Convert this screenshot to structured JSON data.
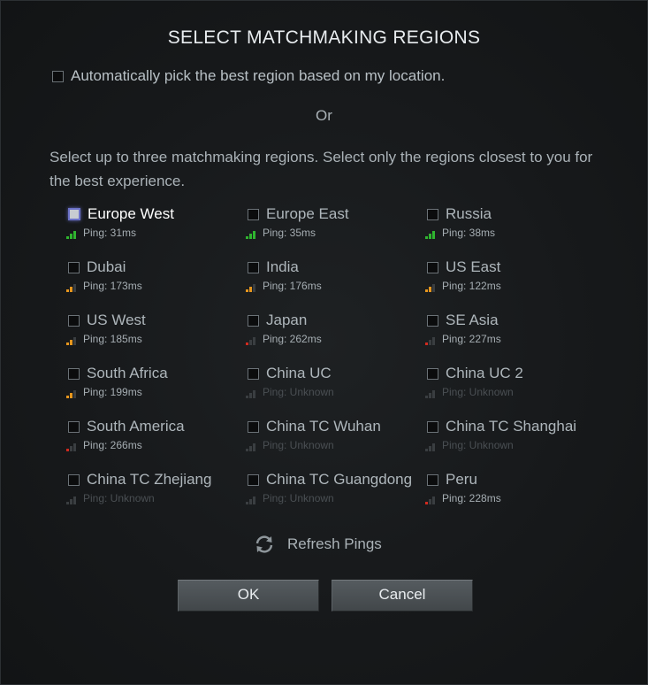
{
  "dialog": {
    "title": "SELECT MATCHMAKING REGIONS",
    "auto_pick_label": "Automatically pick the best region based on my location.",
    "auto_pick_checked": false,
    "or_text": "Or",
    "instructions": "Select up to three matchmaking regions. Select only the regions closest to you for the best experience.",
    "refresh_label": "Refresh Pings",
    "ok_label": "OK",
    "cancel_label": "Cancel"
  },
  "colors": {
    "good": "#2fb52f",
    "medium": "#e6961e",
    "poor": "#d12a1f",
    "unknown": "#3a3e41"
  },
  "regions": [
    {
      "name": "Europe West",
      "ping": "Ping: 31ms",
      "quality": "good",
      "bars": 3,
      "focused": true
    },
    {
      "name": "Europe East",
      "ping": "Ping: 35ms",
      "quality": "good",
      "bars": 3,
      "focused": false
    },
    {
      "name": "Russia",
      "ping": "Ping: 38ms",
      "quality": "good",
      "bars": 3,
      "focused": false
    },
    {
      "name": "Dubai",
      "ping": "Ping: 173ms",
      "quality": "medium",
      "bars": 2,
      "focused": false
    },
    {
      "name": "India",
      "ping": "Ping: 176ms",
      "quality": "medium",
      "bars": 2,
      "focused": false
    },
    {
      "name": "US East",
      "ping": "Ping: 122ms",
      "quality": "medium",
      "bars": 2,
      "focused": false
    },
    {
      "name": "US West",
      "ping": "Ping: 185ms",
      "quality": "medium",
      "bars": 2,
      "focused": false
    },
    {
      "name": "Japan",
      "ping": "Ping: 262ms",
      "quality": "poor",
      "bars": 1,
      "focused": false
    },
    {
      "name": "SE Asia",
      "ping": "Ping: 227ms",
      "quality": "poor",
      "bars": 1,
      "focused": false
    },
    {
      "name": "South Africa",
      "ping": "Ping: 199ms",
      "quality": "medium",
      "bars": 2,
      "focused": false
    },
    {
      "name": "China UC",
      "ping": "Ping: Unknown",
      "quality": "unknown",
      "bars": 0,
      "focused": false
    },
    {
      "name": "China UC 2",
      "ping": "Ping: Unknown",
      "quality": "unknown",
      "bars": 0,
      "focused": false
    },
    {
      "name": "South America",
      "ping": "Ping: 266ms",
      "quality": "poor",
      "bars": 1,
      "focused": false
    },
    {
      "name": "China TC Wuhan",
      "ping": "Ping: Unknown",
      "quality": "unknown",
      "bars": 0,
      "focused": false
    },
    {
      "name": "China TC Shanghai",
      "ping": "Ping: Unknown",
      "quality": "unknown",
      "bars": 0,
      "focused": false
    },
    {
      "name": "China TC Zhejiang",
      "ping": "Ping: Unknown",
      "quality": "unknown",
      "bars": 0,
      "focused": false
    },
    {
      "name": "China TC Guangdong",
      "ping": "Ping: Unknown",
      "quality": "unknown",
      "bars": 0,
      "focused": false
    },
    {
      "name": "Peru",
      "ping": "Ping: 228ms",
      "quality": "poor",
      "bars": 1,
      "focused": false
    }
  ]
}
